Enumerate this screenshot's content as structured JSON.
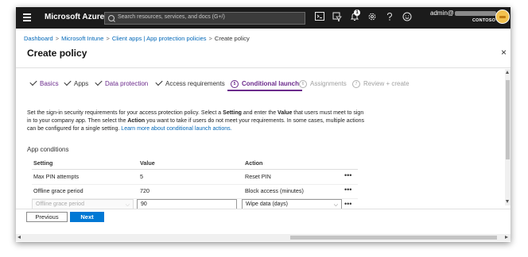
{
  "topbar": {
    "brand": "Microsoft Azure",
    "search_placeholder": "Search resources, services, and docs (G+/)",
    "notification_count": "1",
    "account_name": "admin@",
    "tenant": "CONTOSO",
    "icons": [
      "cloud-shell-icon",
      "directory-filter-icon",
      "notifications-icon",
      "settings-icon",
      "help-icon",
      "feedback-icon"
    ]
  },
  "breadcrumb": {
    "items": [
      "Dashboard",
      "Microsoft Intune",
      "Client apps | App protection policies",
      "Create policy"
    ],
    "separator": ">"
  },
  "page": {
    "title": "Create policy",
    "close": "×"
  },
  "steps": [
    {
      "label": "Basics",
      "state": "done"
    },
    {
      "label": "Apps",
      "state": "done"
    },
    {
      "label": "Data protection",
      "state": "done"
    },
    {
      "label": "Access requirements",
      "state": "done"
    },
    {
      "number": "5",
      "label": "Conditional launch",
      "state": "active"
    },
    {
      "number": "6",
      "label": "Assignments",
      "state": "future"
    },
    {
      "number": "7",
      "label": "Review + create",
      "state": "future"
    }
  ],
  "description": {
    "p1": "Set the sign-in security requirements for your access protection policy. Select a ",
    "b1": "Setting",
    "p2": " and enter the ",
    "b2": "Value",
    "p3": " that users must meet to sign in to your company app. Then select the ",
    "b3": "Action",
    "p4": " you want to take if users do not meet your requirements. In some cases, multiple actions can be configured for a single setting. ",
    "link": "Learn more about conditional launch actions."
  },
  "app_conditions": {
    "title": "App conditions",
    "headers": {
      "setting": "Setting",
      "value": "Value",
      "action": "Action"
    },
    "rows": [
      {
        "setting": "Max PIN attempts",
        "value": "5",
        "action": "Reset PIN",
        "more": "•••"
      },
      {
        "setting": "Offline grace period",
        "value": "720",
        "action": "Block access (minutes)",
        "more": "•••"
      },
      {
        "setting": "Offline grace period",
        "value": "90",
        "action": "Wipe data (days)",
        "more": "•••"
      }
    ]
  },
  "footer": {
    "previous": "Previous",
    "next": "Next"
  },
  "colors": {
    "topbar": "#1b1b1b",
    "accent_purple": "#6b2a8c",
    "primary_blue": "#0078d4",
    "link": "#0067b8"
  }
}
